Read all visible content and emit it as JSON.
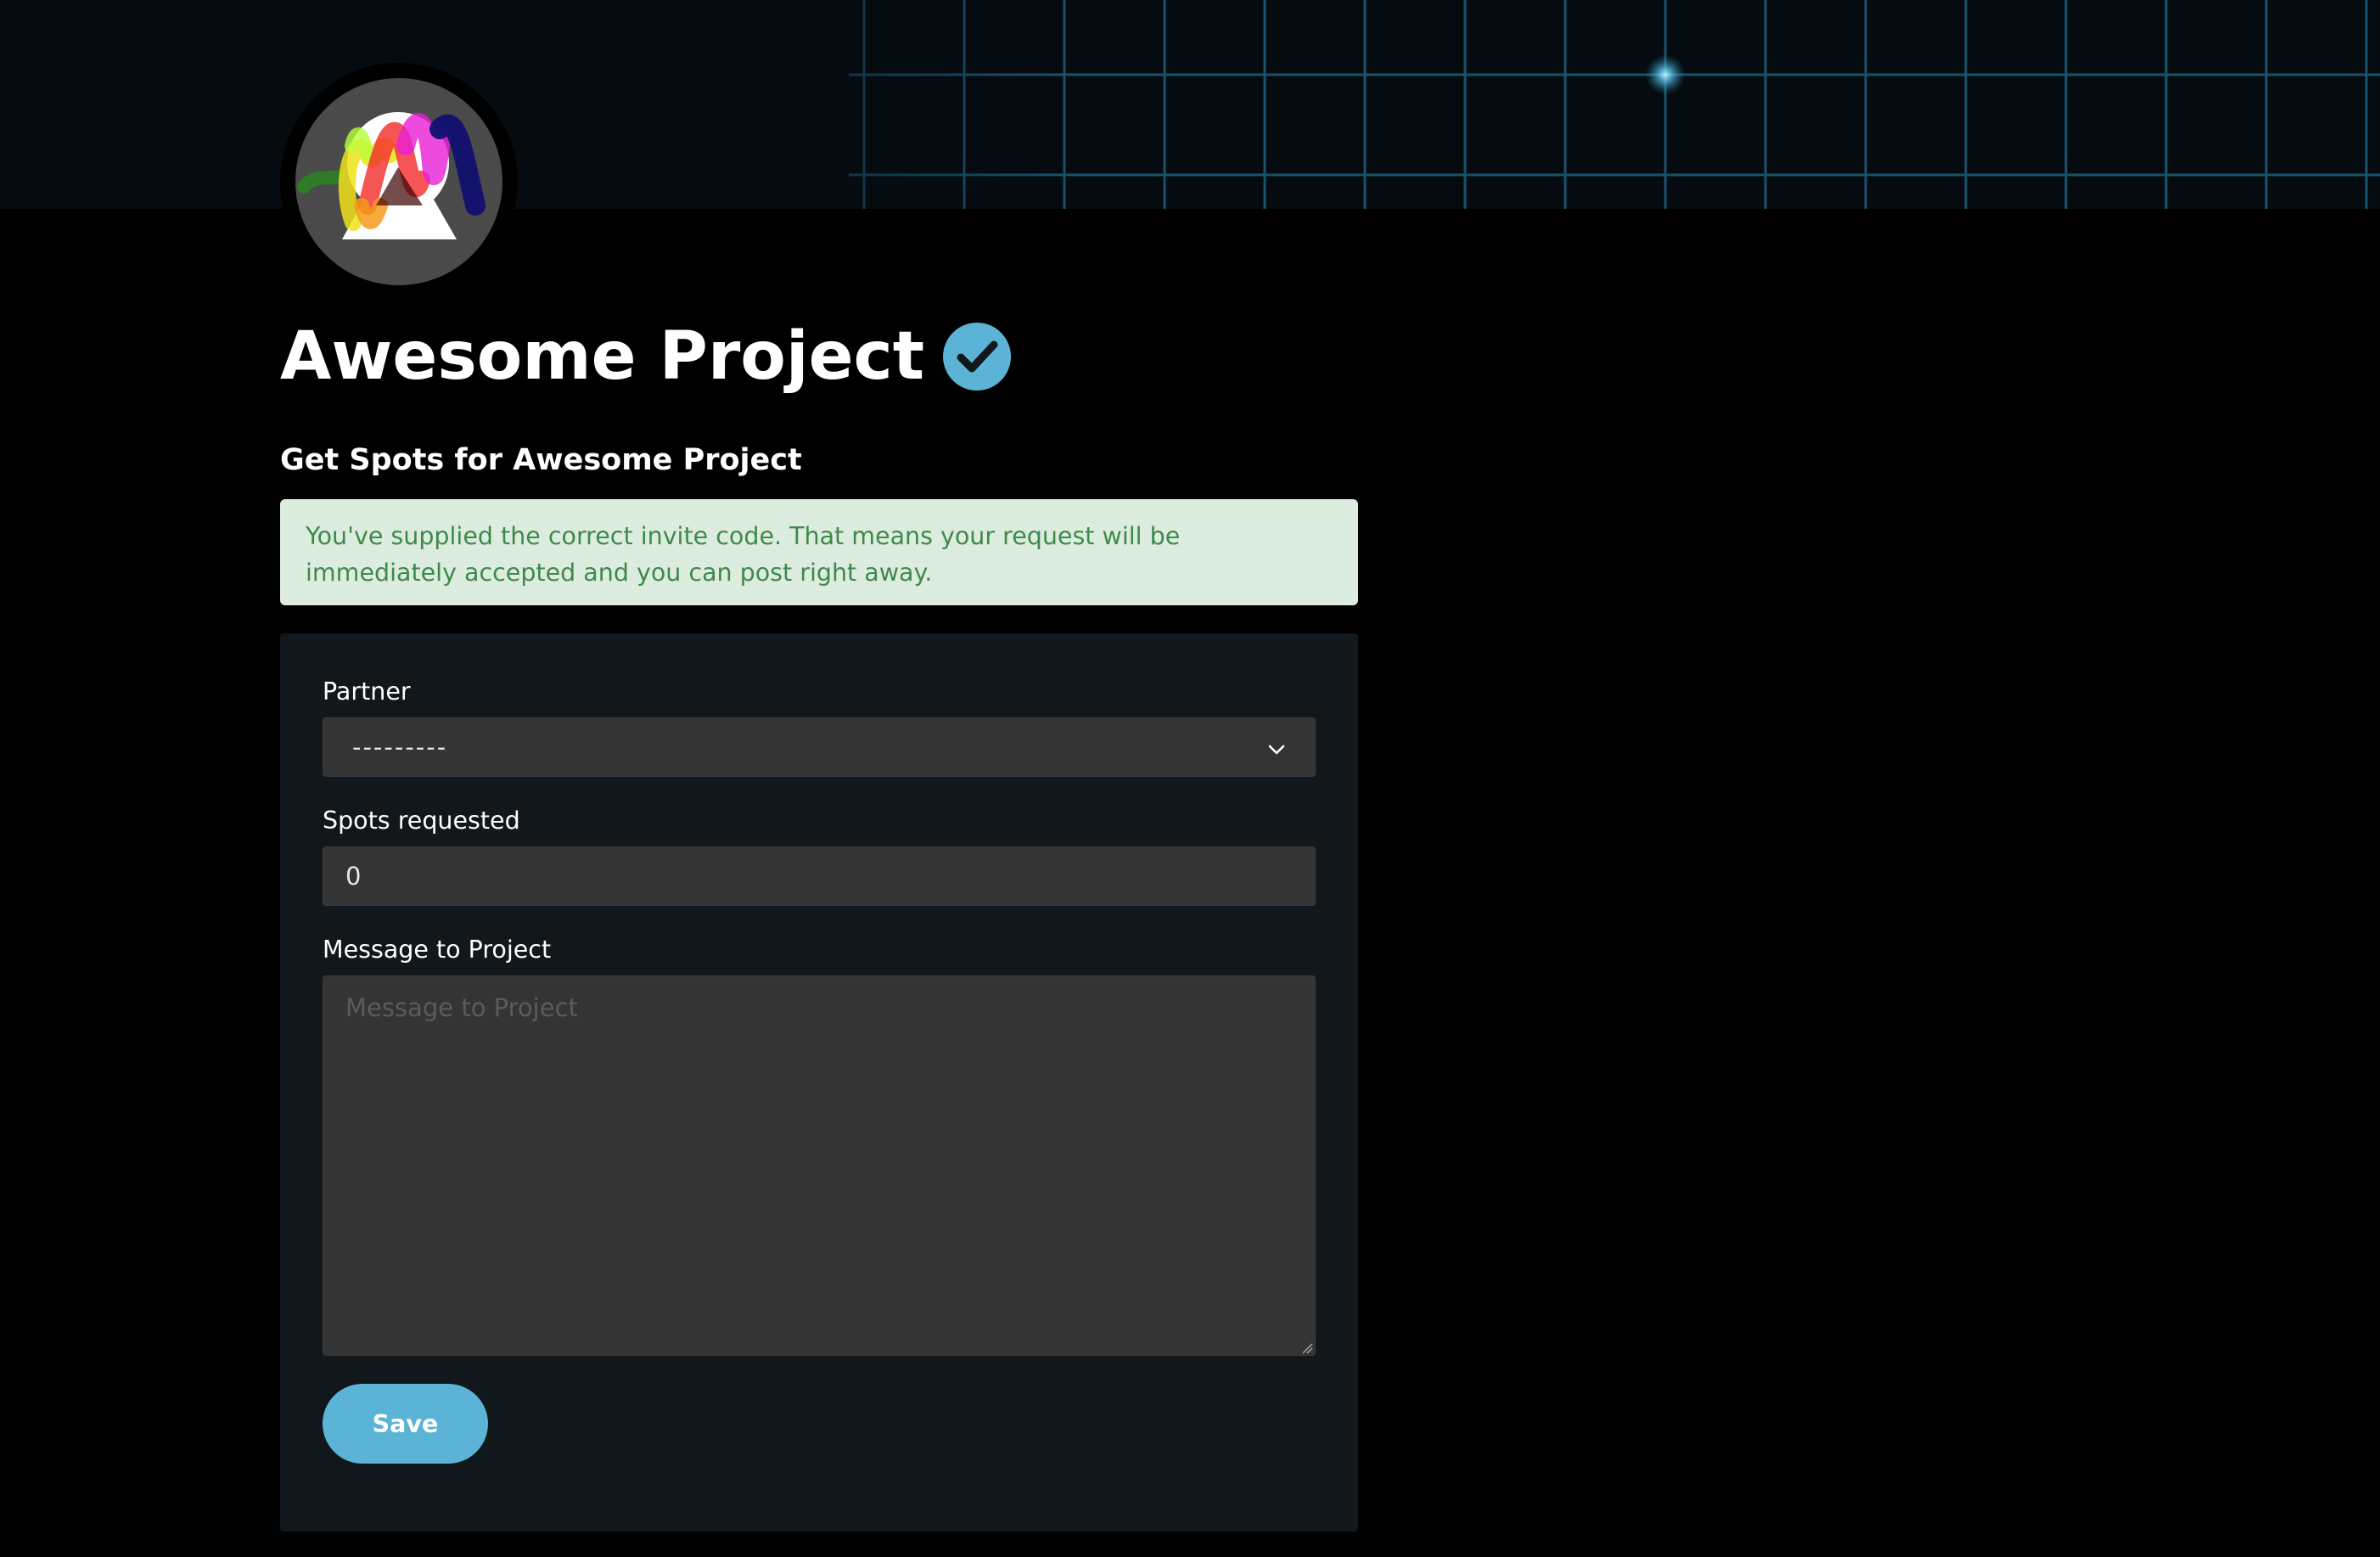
{
  "project": {
    "name": "Awesome Project",
    "verified_icon": "check-circle-icon",
    "logo": "project-logo"
  },
  "page": {
    "heading": "Get Spots for Awesome Project"
  },
  "alert": {
    "text": "You've supplied the correct invite code. That means your request will be immediately accepted and you can post right away."
  },
  "form": {
    "partner": {
      "label": "Partner",
      "selected": "---------",
      "icon": "chevron-down-icon"
    },
    "spots": {
      "label": "Spots requested",
      "value": "0"
    },
    "message": {
      "label": "Message to Project",
      "placeholder": "Message to Project",
      "value": ""
    },
    "save_label": "Save"
  },
  "colors": {
    "accent": "#5bb4d6",
    "background": "#000000",
    "card": "#11171b",
    "field": "#343434",
    "alert_bg": "#dcecdf",
    "alert_text": "#3e8a4c"
  }
}
